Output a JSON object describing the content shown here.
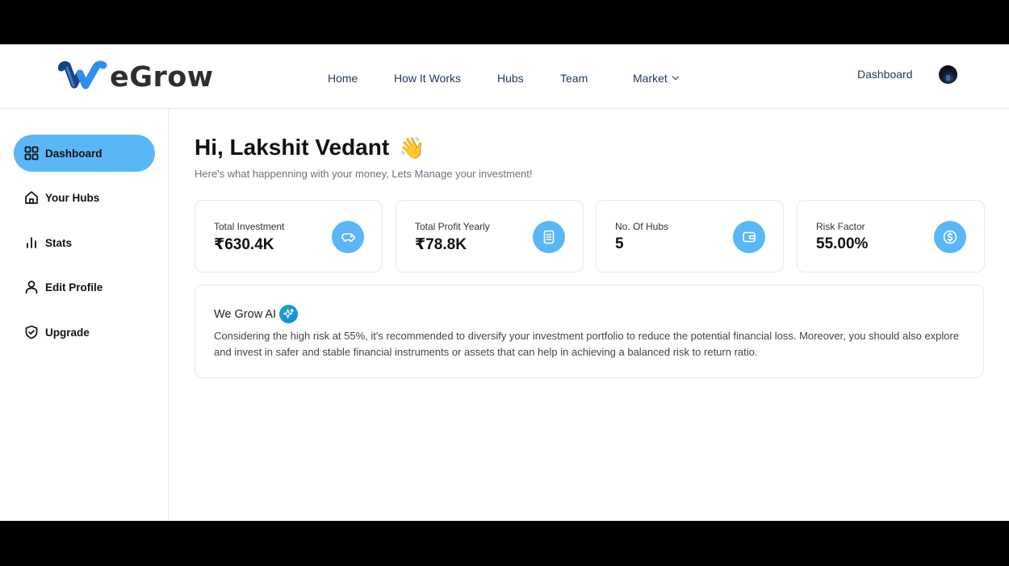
{
  "brand": {
    "name": "eGrow",
    "accent": "#5ab7f6",
    "logo_blue": "#1f6fe0"
  },
  "nav": {
    "home": "Home",
    "how_it_works": "How It Works",
    "hubs": "Hubs",
    "team": "Team",
    "market": "Market",
    "dashboard": "Dashboard"
  },
  "sidebar": {
    "items": [
      {
        "label": "Dashboard",
        "icon": "grid-icon",
        "active": true
      },
      {
        "label": "Your Hubs",
        "icon": "home-icon",
        "active": false
      },
      {
        "label": "Stats",
        "icon": "bar-chart-icon",
        "active": false
      },
      {
        "label": "Edit Profile",
        "icon": "user-icon",
        "active": false
      },
      {
        "label": "Upgrade",
        "icon": "shield-check-icon",
        "active": false
      }
    ]
  },
  "main": {
    "greeting": "Hi, Lakshit Vedant",
    "greeting_emoji": "👋",
    "subtitle": "Here's what happenning with your money, Lets Manage your investment!"
  },
  "cards": [
    {
      "label": "Total Investment",
      "value": "₹630.4K",
      "icon": "piggy-bank-icon"
    },
    {
      "label": "Total Profit Yearly",
      "value": "₹78.8K",
      "icon": "document-icon"
    },
    {
      "label": "No. Of Hubs",
      "value": "5",
      "icon": "wallet-icon"
    },
    {
      "label": "Risk Factor",
      "value": "55.00%",
      "icon": "dollar-circle-icon"
    }
  ],
  "ai": {
    "title": "We Grow AI",
    "icon": "sparkle-icon",
    "message": "Considering the high risk at 55%, it's recommended to diversify your investment portfolio to reduce the potential financial loss. Moreover, you should also explore and invest in safer and stable financial instruments or assets that can help in achieving a balanced risk to return ratio."
  }
}
